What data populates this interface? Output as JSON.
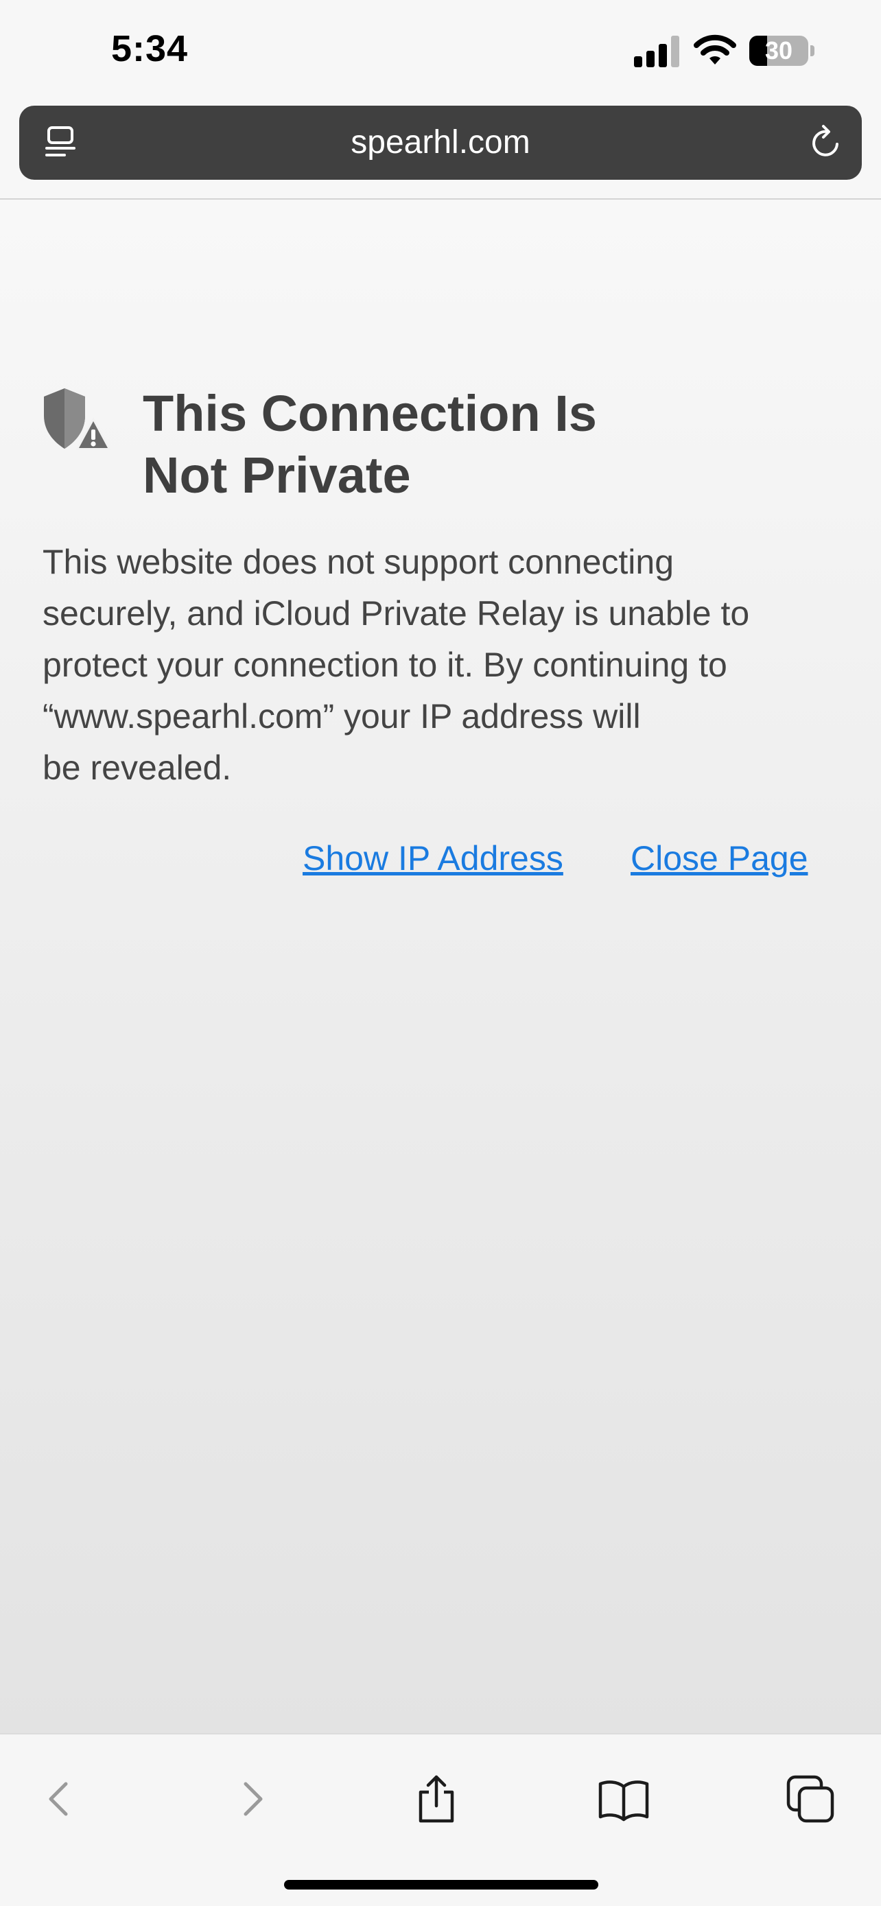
{
  "status_bar": {
    "time": "5:34",
    "battery_percent": "30",
    "battery_level": 0.3,
    "icons": [
      "cellular-signal-icon",
      "wifi-icon",
      "battery-icon"
    ]
  },
  "address_bar": {
    "url": "spearhl.com",
    "left_icon": "reader-view-icon",
    "right_icon": "reload-icon"
  },
  "warning": {
    "icon": "shield-warning-icon",
    "title_line1": "This Connection Is",
    "title_line2": "Not Private",
    "message_line1": "This website does not support connecting",
    "message_line2": "securely, and iCloud Private Relay is unable to",
    "message_line3": "protect your connection to it. By continuing to",
    "message_line4": "“www.spearhl.com” your IP address will",
    "message_line5": "be revealed.",
    "show_ip_label": "Show IP Address",
    "close_page_label": "Close Page",
    "link_color": "#1a7be0"
  },
  "toolbar": {
    "icons": [
      "back-icon",
      "forward-icon",
      "share-icon",
      "bookmarks-icon",
      "tabs-icon"
    ]
  }
}
